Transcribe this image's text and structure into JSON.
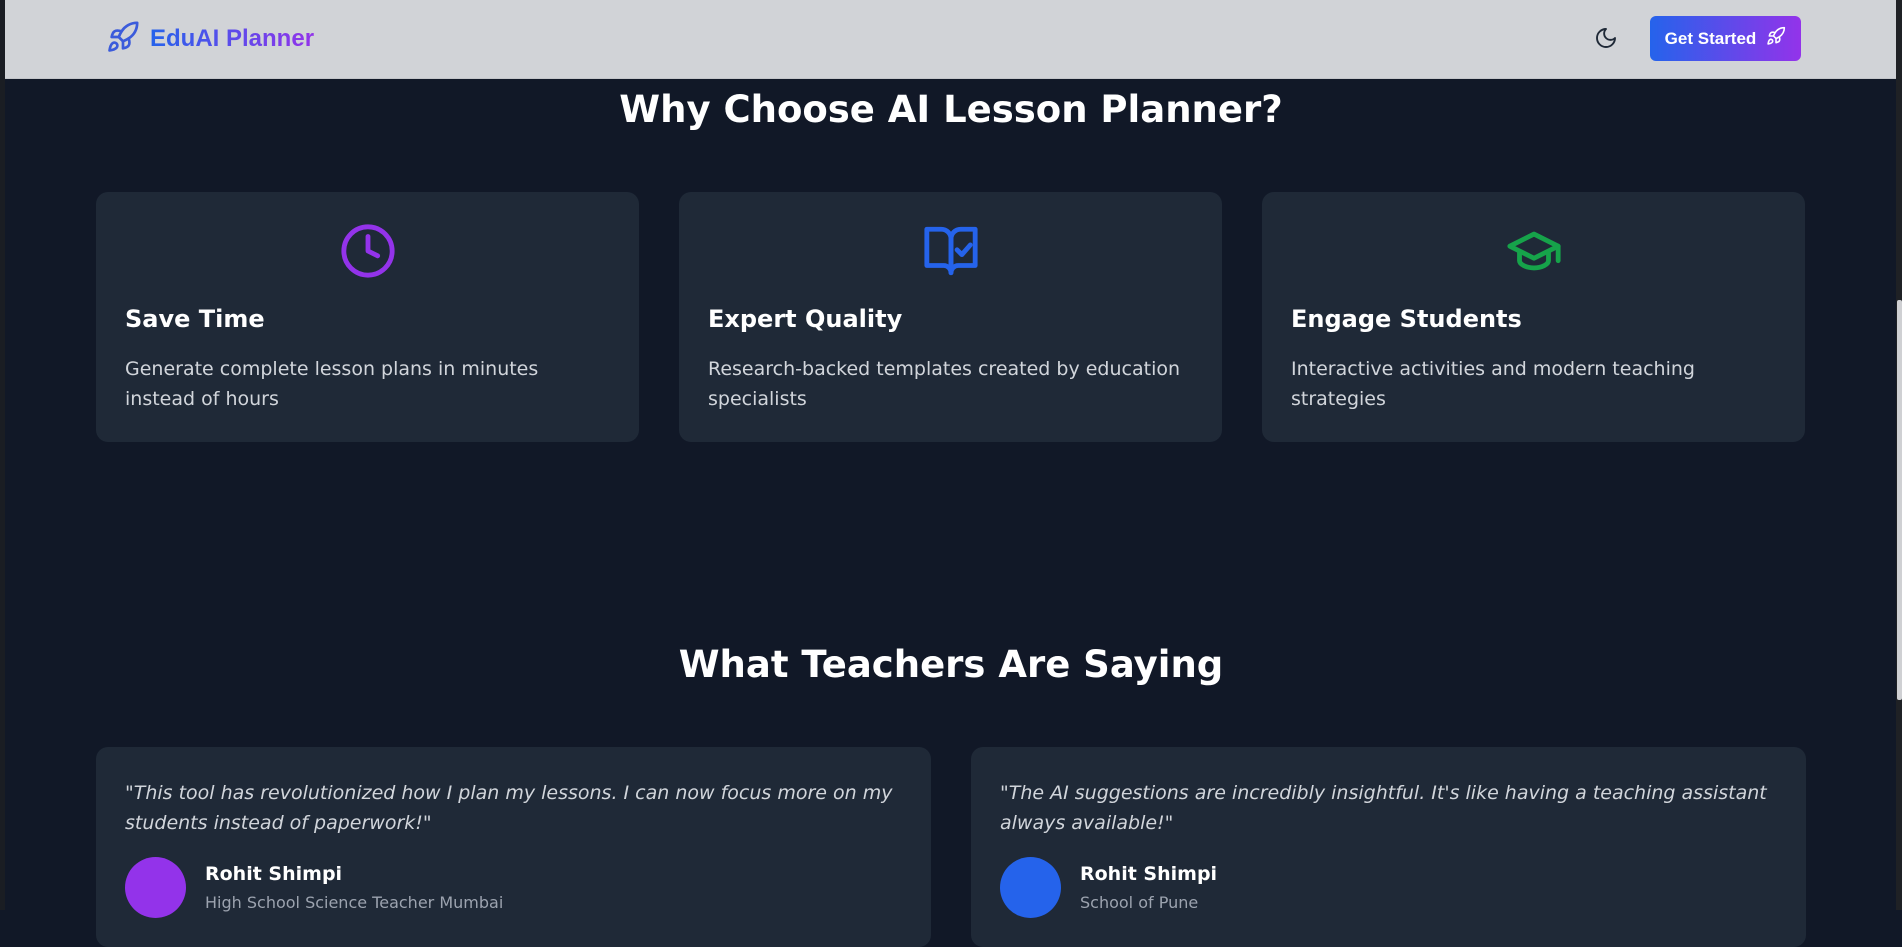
{
  "header": {
    "brand_name": "EduAI Planner",
    "cta_label": "Get Started"
  },
  "features": {
    "title": "Why Choose AI Lesson Planner?",
    "items": [
      {
        "icon": "clock-icon",
        "title": "Save Time",
        "description": "Generate complete lesson plans in minutes instead of hours",
        "icon_color": "#9333ea"
      },
      {
        "icon": "book-check-icon",
        "title": "Expert Quality",
        "description": "Research-backed templates created by education specialists",
        "icon_color": "#2563eb"
      },
      {
        "icon": "graduation-cap-icon",
        "title": "Engage Students",
        "description": "Interactive activities and modern teaching strategies",
        "icon_color": "#16a34a"
      }
    ]
  },
  "testimonials": {
    "title": "What Teachers Are Saying",
    "items": [
      {
        "quote": "\"This tool has revolutionized how I plan my lessons. I can now focus more on my students instead of paperwork!\"",
        "name": "Rohit Shimpi",
        "role": "High School Science Teacher Mumbai",
        "avatar_color": "#9333ea"
      },
      {
        "quote": "\"The AI suggestions are incredibly insightful. It's like having a teaching assistant always available!\"",
        "name": "Rohit Shimpi",
        "role": "School of Pune",
        "avatar_color": "#2563eb"
      }
    ]
  },
  "colors": {
    "page_background": "#111827",
    "card_background": "#1f2937",
    "header_background": "#d1d3d7",
    "brand_gradient_start": "#2563eb",
    "brand_gradient_end": "#9333ea"
  }
}
